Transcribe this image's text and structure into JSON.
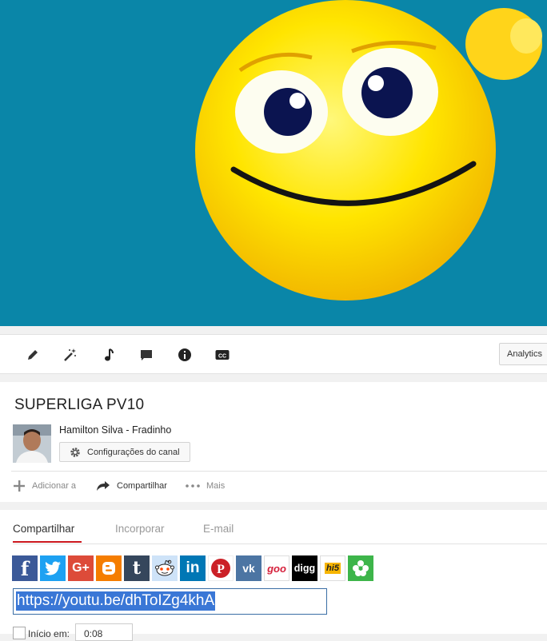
{
  "video": {
    "background": "#0a86a8",
    "image": "smiley-face-thumbnail"
  },
  "toolbar": {
    "icons": [
      "pencil-icon",
      "magic-wand-icon",
      "music-note-icon",
      "comment-icon",
      "info-icon",
      "cc-icon"
    ],
    "analytics_label": "Analytics"
  },
  "info": {
    "title": "SUPERLIGA PV10",
    "channel_name": "Hamilton Silva - Fradinho",
    "config_label": "Configurações do canal",
    "actions": {
      "add": "Adicionar a",
      "share": "Compartilhar",
      "more": "Mais"
    }
  },
  "share": {
    "tabs": [
      "Compartilhar",
      "Incorporar",
      "E-mail"
    ],
    "active_tab": "Compartilhar",
    "social": [
      {
        "name": "facebook",
        "label": "f",
        "color": "#3b5998"
      },
      {
        "name": "twitter",
        "label": "t",
        "color": "#1da1f2"
      },
      {
        "name": "google-plus",
        "label": "G+",
        "color": "#dd4b39"
      },
      {
        "name": "blogger",
        "label": "B",
        "color": "#f57d00"
      },
      {
        "name": "tumblr",
        "label": "t",
        "color": "#35465c"
      },
      {
        "name": "reddit",
        "label": "r",
        "color": "#cee3f8"
      },
      {
        "name": "linkedin",
        "label": "in",
        "color": "#0077b5"
      },
      {
        "name": "pinterest",
        "label": "P",
        "color": "#ffffff"
      },
      {
        "name": "vk",
        "label": "vk",
        "color": "#4c75a3"
      },
      {
        "name": "goo",
        "label": "goo",
        "color": "#ffffff"
      },
      {
        "name": "digg",
        "label": "digg",
        "color": "#000000"
      },
      {
        "name": "hi5",
        "label": "hi5",
        "color": "#ffffff"
      },
      {
        "name": "share-other",
        "label": "*",
        "color": "#3db54a"
      }
    ],
    "url": "https://youtu.be/dhToIZg4khA",
    "start_label": "Início em:",
    "start_time": "0:08"
  }
}
